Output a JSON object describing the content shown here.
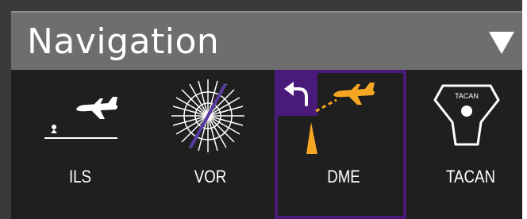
{
  "header": {
    "title": "Navigation"
  },
  "tiles": [
    {
      "label": "ILS",
      "icon": "ils-icon",
      "selected": false
    },
    {
      "label": "VOR",
      "icon": "vor-icon",
      "selected": false
    },
    {
      "label": "DME",
      "icon": "dme-icon",
      "selected": true
    },
    {
      "label": "TACAN",
      "icon": "tacan-icon",
      "selected": false
    }
  ],
  "tacan_icon_text": "TACAN",
  "colors": {
    "panel_bg": "#1f1f1f",
    "header_bg": "#6e6e6e",
    "selection": "#4a1a7a",
    "accent_orange": "#f5a623",
    "vor_needle": "#5a3aa0",
    "text": "#ffffff"
  }
}
